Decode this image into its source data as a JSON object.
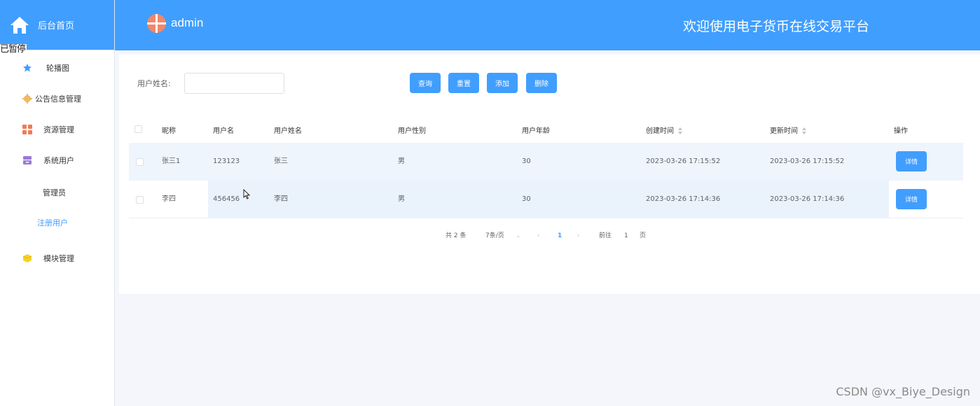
{
  "sidebar": {
    "brand_label": "后台首页",
    "paused_label": "已暂停",
    "menu": [
      {
        "label": "轮播图",
        "icon": "star-icon"
      },
      {
        "label": "公告信息管理",
        "icon": "gear-icon"
      },
      {
        "label": "资源管理",
        "icon": "grid-icon"
      },
      {
        "label": "系统用户",
        "icon": "archive-icon"
      },
      {
        "label": "模块管理",
        "icon": "cube-icon"
      }
    ],
    "submenu": [
      {
        "label": "管理员",
        "active": false
      },
      {
        "label": "注册用户",
        "active": true
      }
    ]
  },
  "header": {
    "admin_name": "admin",
    "platform_title": "欢迎使用电子货币在线交易平台"
  },
  "search": {
    "label": "用户姓名:",
    "value": "",
    "buttons": {
      "query": "查询",
      "reset": "重置",
      "add": "添加",
      "delete": "删除"
    }
  },
  "table": {
    "columns": [
      "昵称",
      "用户名",
      "用户姓名",
      "用户性别",
      "用户年龄",
      "创建时间",
      "更新时间",
      "操作"
    ],
    "rows": [
      {
        "nickname": "张三1",
        "username": "123123",
        "realname": "张三",
        "gender": "男",
        "age": "30",
        "created": "2023-03-26 17:15:52",
        "updated": "2023-03-26 17:15:52",
        "action": "详情"
      },
      {
        "nickname": "李四",
        "username": "456456",
        "realname": "李四",
        "gender": "男",
        "age": "30",
        "created": "2023-03-26 17:14:36",
        "updated": "2023-03-26 17:14:36",
        "action": "详情"
      }
    ]
  },
  "pagination": {
    "total": "共 2 条",
    "page_size": "7条/页",
    "current_page": "1",
    "goto_label": "前往",
    "goto_value": "1",
    "page_unit": "页"
  },
  "watermark": "CSDN @vx_Biye_Design",
  "colors": {
    "primary": "#409eff",
    "star": "#409eff",
    "gear": "#f0b65a",
    "grid": "#f07b54",
    "archive": "#9b7bd6",
    "cube": "#f5d228"
  }
}
